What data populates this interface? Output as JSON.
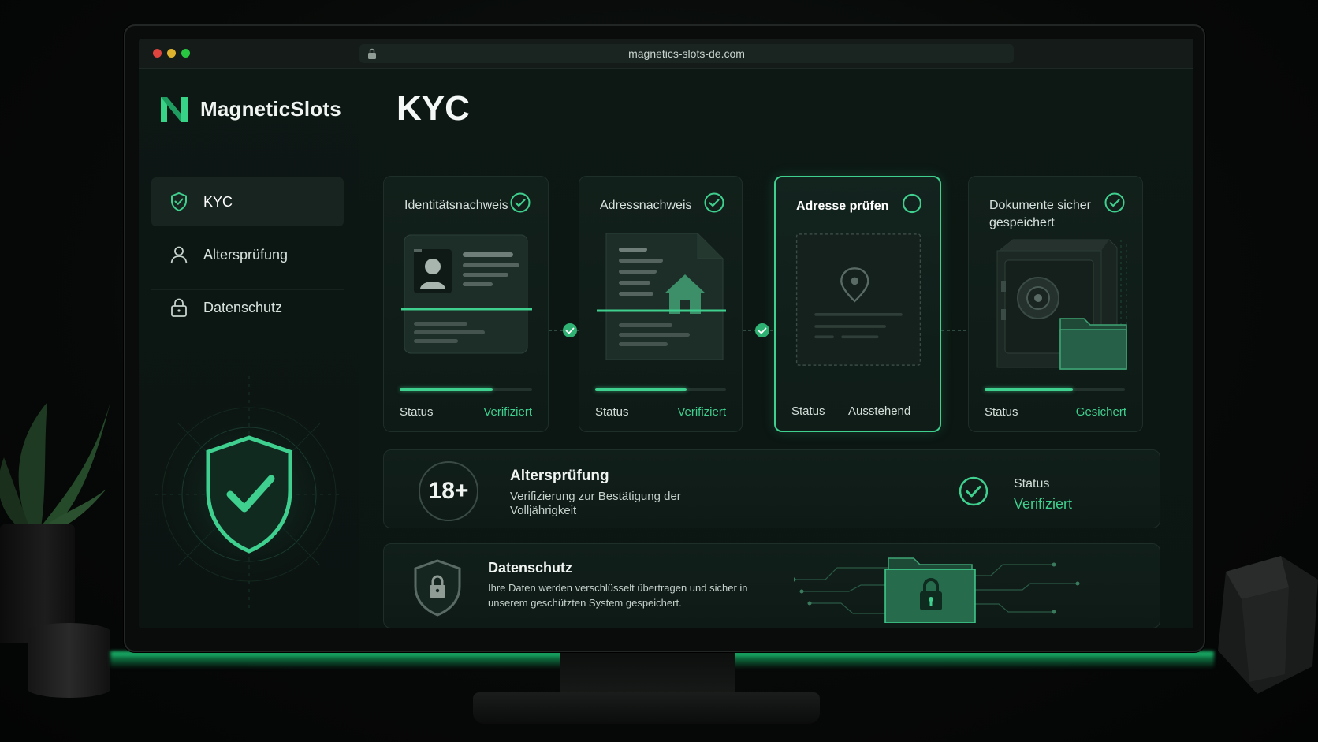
{
  "browser": {
    "url": "magnetics-slots-de.com"
  },
  "brand": {
    "name": "MagneticSlots",
    "accent": "#3fcf8e"
  },
  "sidebar": {
    "items": [
      {
        "label": "KYC",
        "icon": "shield-check-icon",
        "active": true
      },
      {
        "label": "Altersprüfung",
        "icon": "user-icon",
        "active": false
      },
      {
        "label": "Datenschutz",
        "icon": "lock-icon",
        "active": false
      }
    ]
  },
  "page": {
    "title": "KYC"
  },
  "steps": [
    {
      "title": "Identitätsnachweis",
      "status_label": "Status",
      "status_value": "Verifiziert",
      "done": true,
      "progress": 0.7,
      "icon": "id-card-icon"
    },
    {
      "title": "Adressnachweis",
      "status_label": "Status",
      "status_value": "Verifiziert",
      "done": true,
      "progress": 0.7,
      "icon": "house-document-icon"
    },
    {
      "title": "Adresse prüfen",
      "status_label": "Status",
      "status_value": "Ausstehend",
      "done": false,
      "progress": 0,
      "icon": "location-pin-icon"
    },
    {
      "title": "Dokumente sicher gespeichert",
      "status_label": "Status",
      "status_value": "Gesichert",
      "done": true,
      "progress": 0.63,
      "icon": "safe-icon"
    }
  ],
  "age_check": {
    "badge": "18+",
    "title": "Altersprüfung",
    "description": "Verifizierung zur Bestätigung der Volljährigkeit",
    "status_label": "Status",
    "status_value": "Verifiziert"
  },
  "privacy": {
    "title": "Datenschutz",
    "description": "Ihre Daten werden verschlüsselt übertragen und sicher in unserem geschützten System gespeichert."
  }
}
